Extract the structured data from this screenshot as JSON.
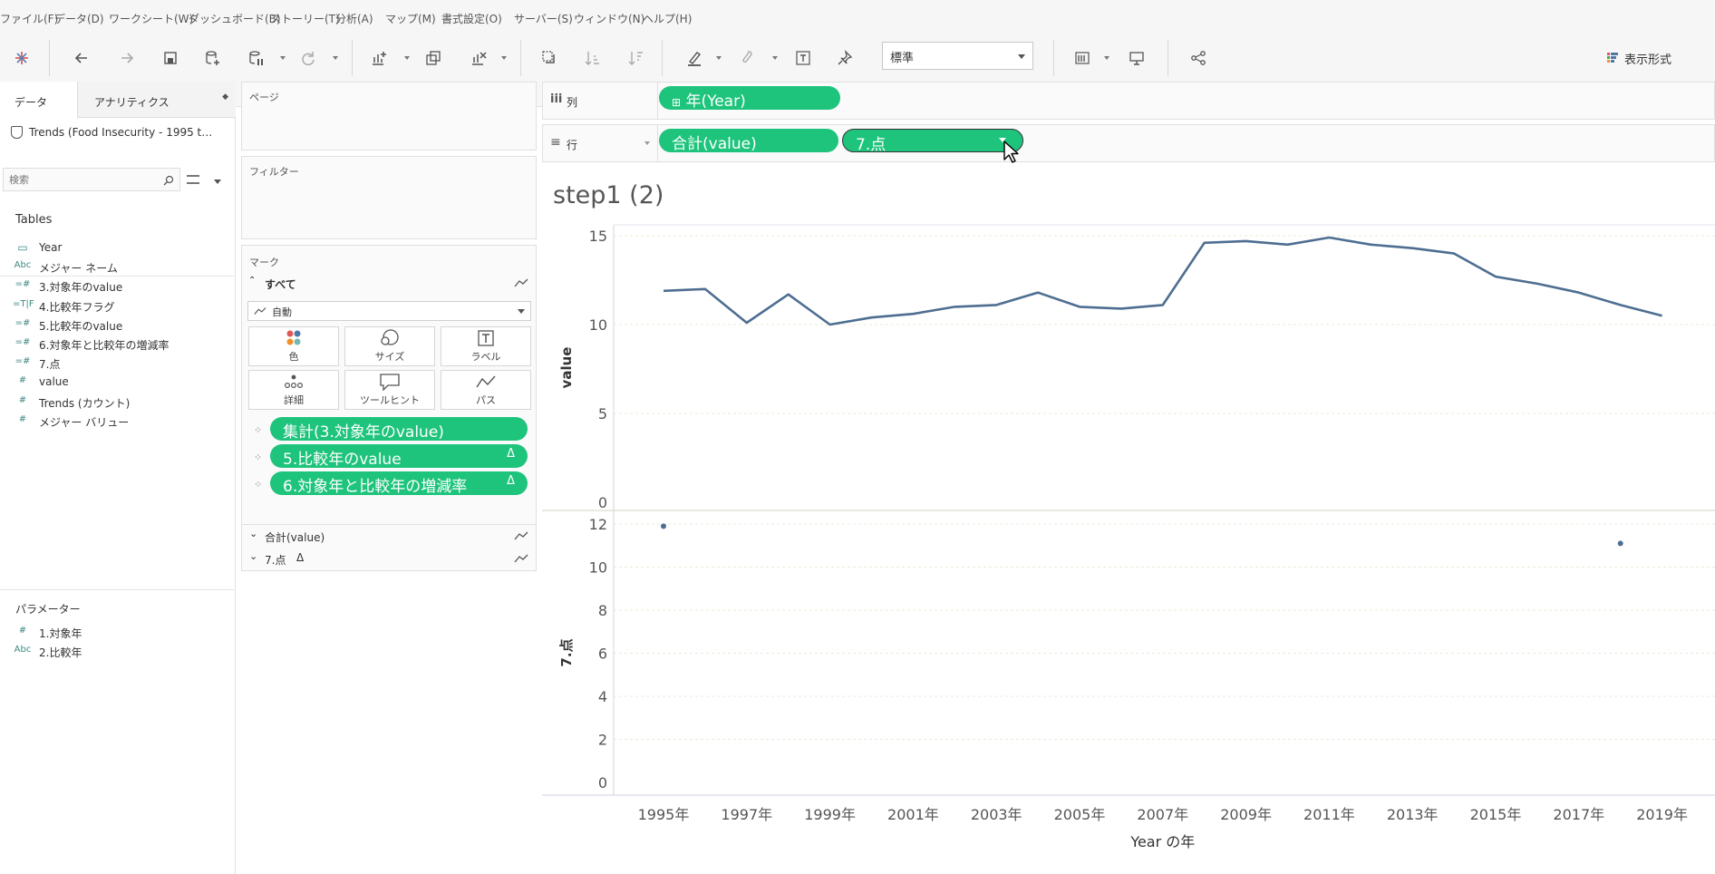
{
  "menu": [
    "ファイル(F)",
    "データ(D)",
    "ワークシート(W)",
    "ダッシュボード(B)",
    "ストーリー(T)",
    "分析(A)",
    "マップ(M)",
    "書式設定(O)",
    "サーバー(S)",
    "ウィンドウ(N)",
    "ヘルプ(H)"
  ],
  "toolbar": {
    "fit_value": "標準",
    "show_me_label": "表示形式"
  },
  "data_pane": {
    "tabs": [
      "データ",
      "アナリティクス"
    ],
    "datasource": "Trends (Food Insecurity - 1995 t…",
    "search_placeholder": "検索",
    "tables_header": "Tables",
    "fields": [
      {
        "icon": "calendar",
        "label": "Year"
      },
      {
        "icon": "Abc",
        "label": "メジャー ネーム"
      },
      {
        "icon": "=#",
        "label": "3.対象年のvalue"
      },
      {
        "icon": "=T|F",
        "label": "4.比較年フラグ"
      },
      {
        "icon": "=#",
        "label": "5.比較年のvalue"
      },
      {
        "icon": "=#",
        "label": "6.対象年と比較年の増減率"
      },
      {
        "icon": "=#",
        "label": "7.点"
      },
      {
        "icon": "#",
        "label": "value"
      },
      {
        "icon": "#",
        "label": "Trends (カウント)"
      },
      {
        "icon": "#",
        "label": "メジャー バリュー"
      }
    ],
    "parameters_header": "パラメーター",
    "parameters": [
      {
        "icon": "#",
        "label": "1.対象年"
      },
      {
        "icon": "Abc",
        "label": "2.比較年"
      }
    ]
  },
  "pages_label": "ページ",
  "filters_label": "フィルター",
  "marks": {
    "header": "マーク",
    "all_label": "すべて",
    "mark_type": "自動",
    "buttons": [
      "色",
      "サイズ",
      "ラベル",
      "詳細",
      "ツールヒント",
      "パス"
    ],
    "pills": [
      "集計(3.対象年のvalue)",
      "5.比較年のvalue",
      "6.対象年と比較年の増減率"
    ],
    "delta_symbol": "Δ",
    "cards": [
      "合計(value)",
      "7.点"
    ]
  },
  "shelves": {
    "columns_label": "列",
    "rows_label": "行",
    "columns_pills": [
      "年(Year)"
    ],
    "rows_pills": [
      "合計(value)",
      "7.点"
    ]
  },
  "colors": {
    "pill": "#1ec47c",
    "line": "#4e6e91"
  },
  "chart_data": {
    "title": "step1 (2)",
    "type": "line",
    "xlabel": "Year の年",
    "x_categories": [
      "1995年",
      "1996年",
      "1997年",
      "1998年",
      "1999年",
      "2000年",
      "2001年",
      "2002年",
      "2003年",
      "2004年",
      "2005年",
      "2006年",
      "2007年",
      "2008年",
      "2009年",
      "2010年",
      "2011年",
      "2012年",
      "2013年",
      "2014年",
      "2015年",
      "2016年",
      "2017年",
      "2018年",
      "2019年"
    ],
    "x_tick_labels": [
      "1995年",
      "1997年",
      "1999年",
      "2001年",
      "2003年",
      "2005年",
      "2007年",
      "2009年",
      "2011年",
      "2013年",
      "2015年",
      "2017年",
      "2019年"
    ],
    "panes": [
      {
        "ylabel": "value",
        "ylim": [
          0,
          15.5
        ],
        "yticks": [
          0,
          5,
          10,
          15
        ],
        "type": "line",
        "values": [
          11.9,
          12.0,
          10.1,
          11.7,
          10.0,
          10.4,
          10.6,
          11.0,
          11.1,
          11.8,
          11.0,
          10.9,
          11.1,
          14.6,
          14.7,
          14.5,
          14.9,
          14.5,
          14.3,
          14.0,
          12.7,
          12.3,
          11.8,
          11.1,
          10.5
        ]
      },
      {
        "ylabel": "7.点",
        "ylim": [
          0,
          12.4
        ],
        "yticks": [
          0,
          2,
          4,
          6,
          8,
          10,
          12
        ],
        "type": "scatter",
        "points": [
          {
            "x": "1995年",
            "y": 11.9
          },
          {
            "x": "2018年",
            "y": 11.1
          }
        ]
      }
    ]
  }
}
